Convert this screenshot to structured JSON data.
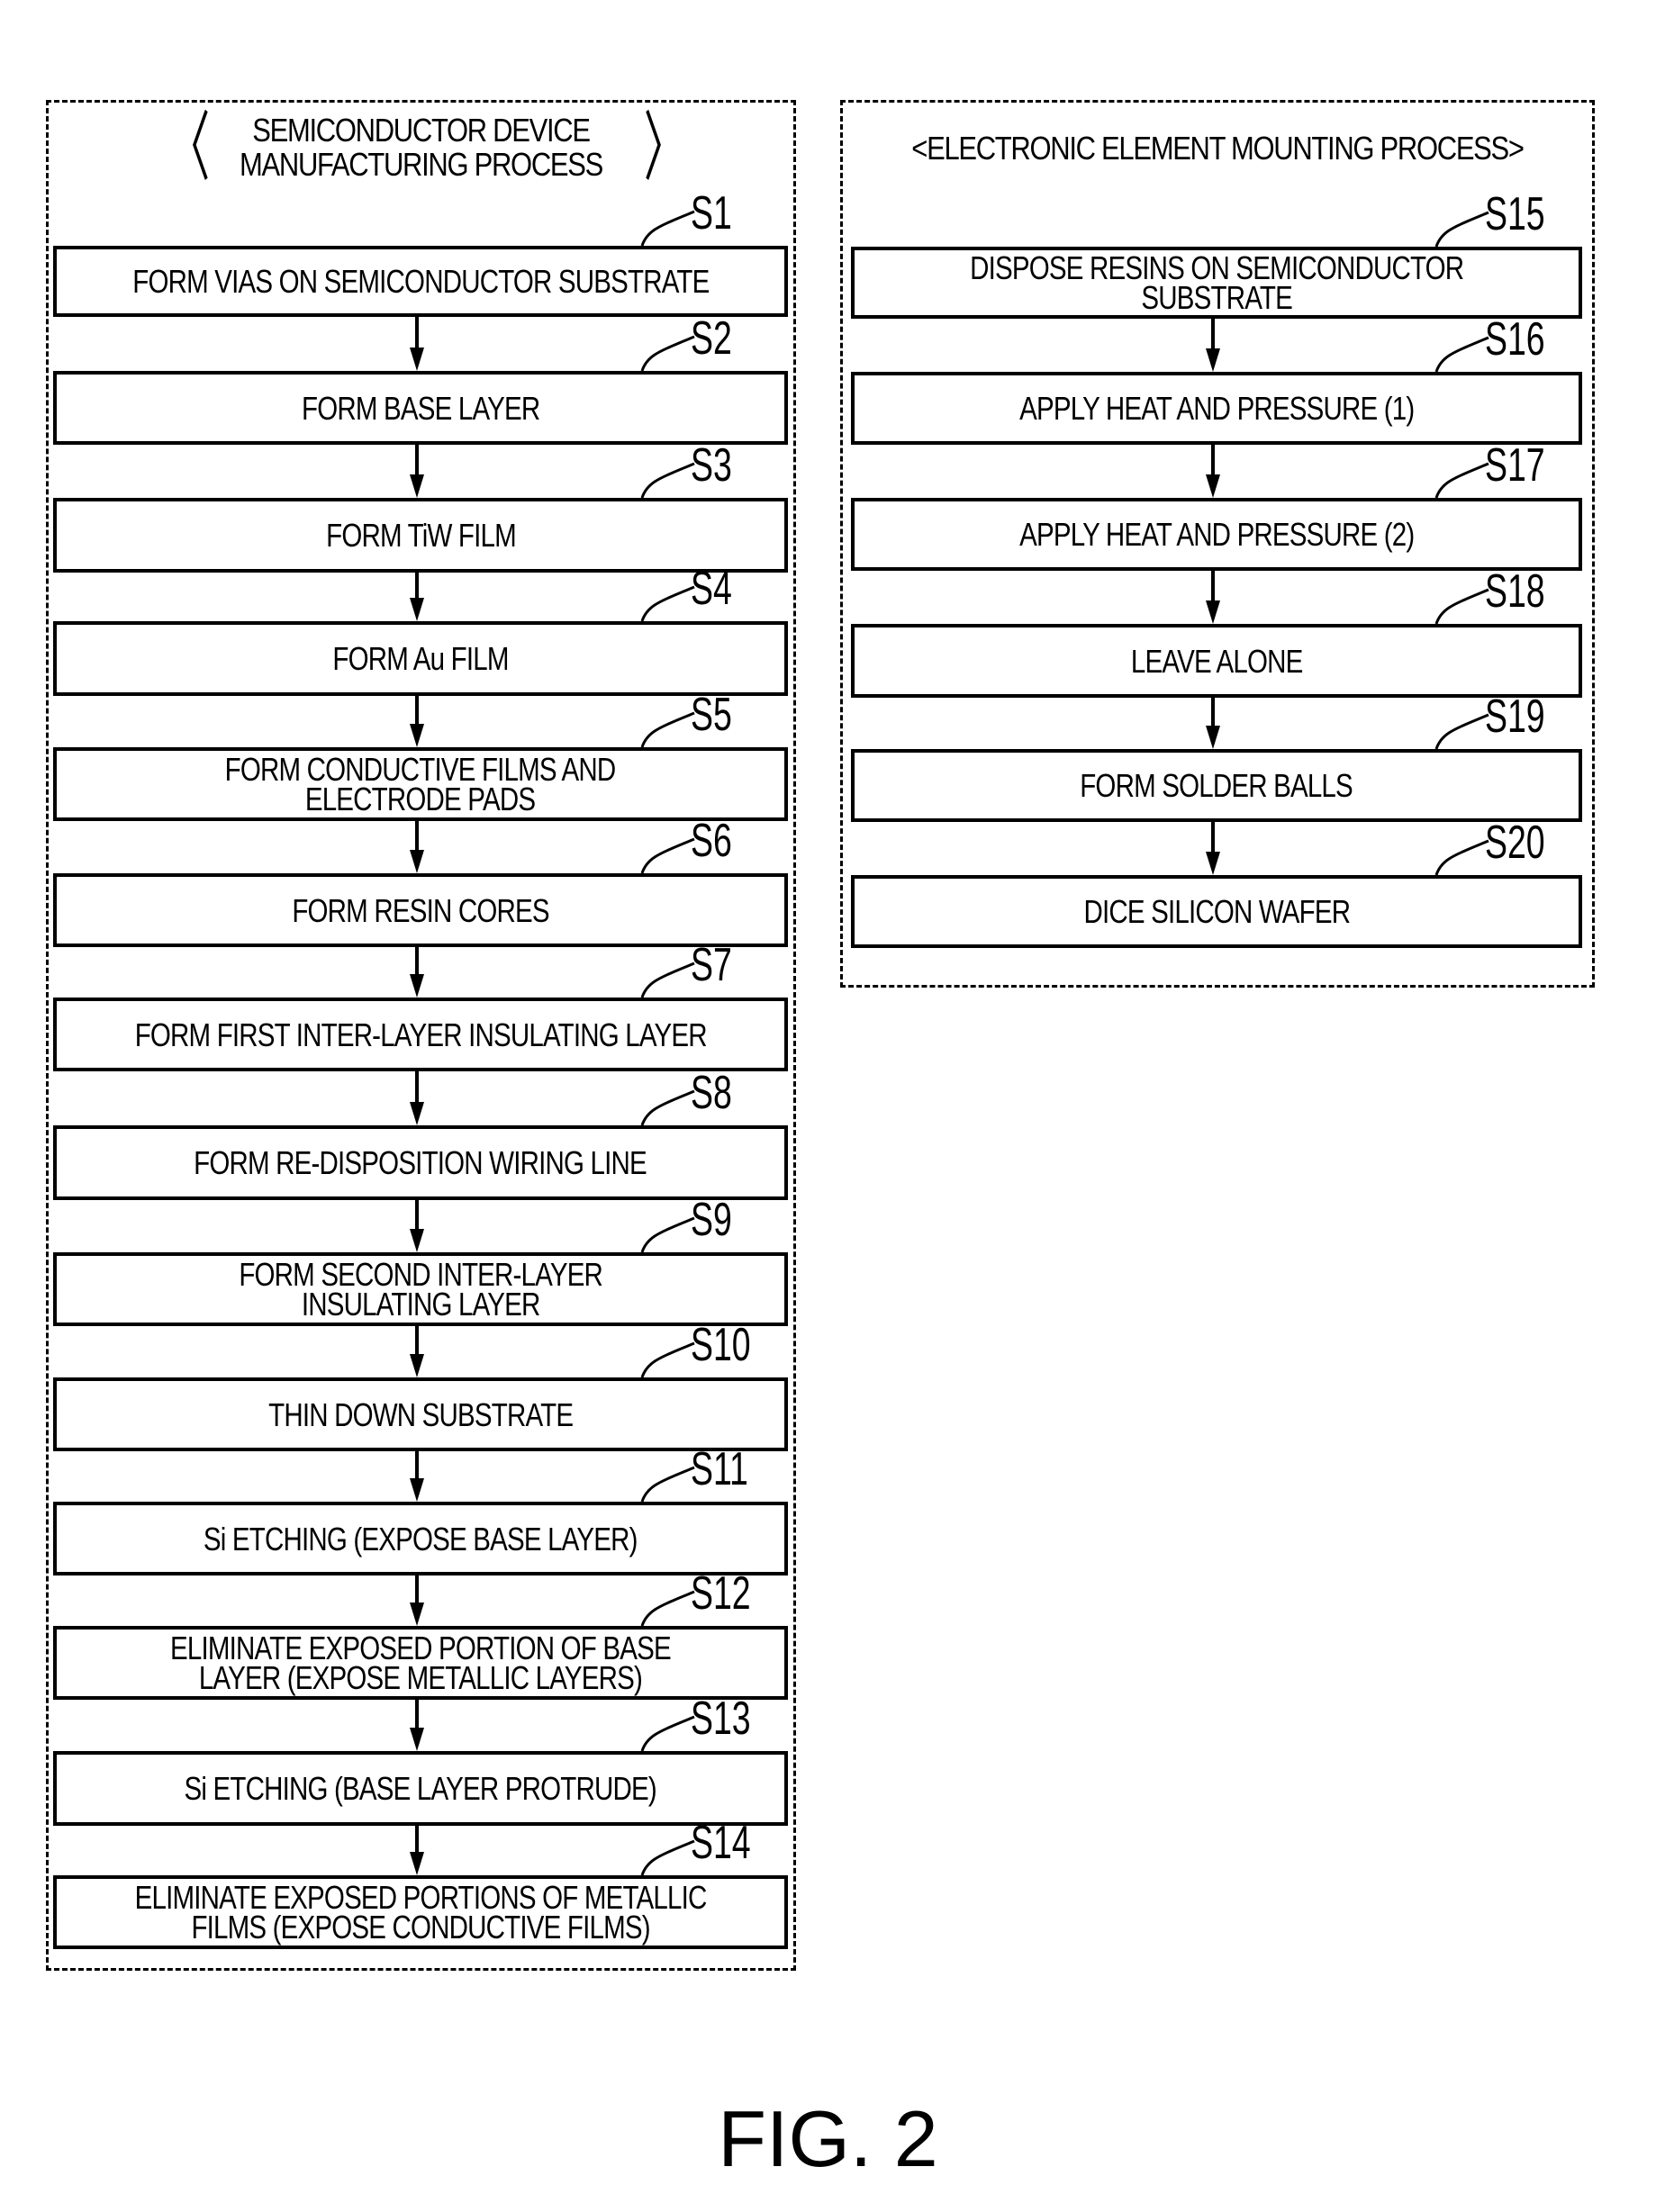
{
  "figure_label": "FIG. 2",
  "left_process": {
    "title_line1": "SEMICONDUCTOR DEVICE",
    "title_line2": "MANUFACTURING PROCESS",
    "title_open_bracket": "〈",
    "title_close_bracket": "〉",
    "steps": [
      {
        "id": "S1",
        "label": "FORM VIAS ON SEMICONDUCTOR SUBSTRATE"
      },
      {
        "id": "S2",
        "label": "FORM BASE LAYER"
      },
      {
        "id": "S3",
        "label": "FORM TiW FILM"
      },
      {
        "id": "S4",
        "label": "FORM Au FILM"
      },
      {
        "id": "S5",
        "label": "FORM CONDUCTIVE FILMS AND\nELECTRODE PADS"
      },
      {
        "id": "S6",
        "label": "FORM RESIN CORES"
      },
      {
        "id": "S7",
        "label": "FORM FIRST INTER-LAYER INSULATING LAYER"
      },
      {
        "id": "S8",
        "label": "FORM RE-DISPOSITION WIRING LINE"
      },
      {
        "id": "S9",
        "label": "FORM SECOND INTER-LAYER\nINSULATING LAYER"
      },
      {
        "id": "S10",
        "label": "THIN DOWN SUBSTRATE"
      },
      {
        "id": "S11",
        "label": "Si ETCHING (EXPOSE BASE LAYER)"
      },
      {
        "id": "S12",
        "label": "ELIMINATE EXPOSED PORTION OF BASE\nLAYER (EXPOSE METALLIC LAYERS)"
      },
      {
        "id": "S13",
        "label": "Si ETCHING (BASE LAYER PROTRUDE)"
      },
      {
        "id": "S14",
        "label": "ELIMINATE EXPOSED PORTIONS OF METALLIC\nFILMS (EXPOSE CONDUCTIVE FILMS)"
      }
    ]
  },
  "right_process": {
    "title": "<ELECTRONIC ELEMENT MOUNTING PROCESS>",
    "steps": [
      {
        "id": "S15",
        "label": "DISPOSE RESINS ON SEMICONDUCTOR\nSUBSTRATE"
      },
      {
        "id": "S16",
        "label": "APPLY HEAT AND PRESSURE (1)"
      },
      {
        "id": "S17",
        "label": "APPLY HEAT AND PRESSURE (2)"
      },
      {
        "id": "S18",
        "label": "LEAVE ALONE"
      },
      {
        "id": "S19",
        "label": "FORM SOLDER BALLS"
      },
      {
        "id": "S20",
        "label": "DICE SILICON WAFER"
      }
    ]
  }
}
